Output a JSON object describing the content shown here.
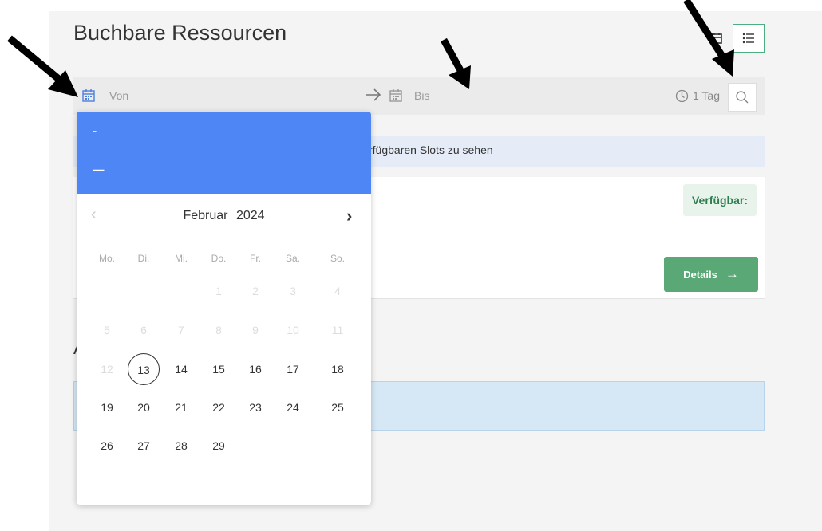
{
  "page": {
    "title": "Buchbare Ressourcen"
  },
  "filter": {
    "from_label": "Von",
    "to_label": "Bis",
    "duration": "1 Tag"
  },
  "info": {
    "text": "rfügbaren Slots zu sehen"
  },
  "card": {
    "badge": "Verfügbar:",
    "details_label": "Details",
    "details_arrow": "→"
  },
  "section": {
    "letter_visible": "A"
  },
  "datepicker": {
    "header_line1": "-",
    "header_line2": "–",
    "month": "Februar",
    "year": "2024",
    "prev": "‹",
    "next": "›",
    "weekdays": [
      "Mo.",
      "Di.",
      "Mi.",
      "Do.",
      "Fr.",
      "Sa.",
      "So."
    ],
    "weeks": [
      [
        "",
        "",
        "",
        "1",
        "2",
        "3",
        "4"
      ],
      [
        "5",
        "6",
        "7",
        "8",
        "9",
        "10",
        "11"
      ],
      [
        "12",
        "13",
        "14",
        "15",
        "16",
        "17",
        "18"
      ],
      [
        "19",
        "20",
        "21",
        "22",
        "23",
        "24",
        "25"
      ],
      [
        "26",
        "27",
        "28",
        "29",
        "",
        "",
        ""
      ]
    ],
    "today": "13"
  },
  "colors": {
    "accent_blue": "#4f86f5",
    "green": "#5aa876",
    "badge_bg": "#e8f3ec",
    "info_bg": "#e5ecf8"
  },
  "icons": [
    "calendar-icon",
    "list-icon",
    "arrow-right-icon",
    "clock-icon",
    "search-icon",
    "chevron-left-icon",
    "chevron-right-icon",
    "annotation-arrow"
  ]
}
